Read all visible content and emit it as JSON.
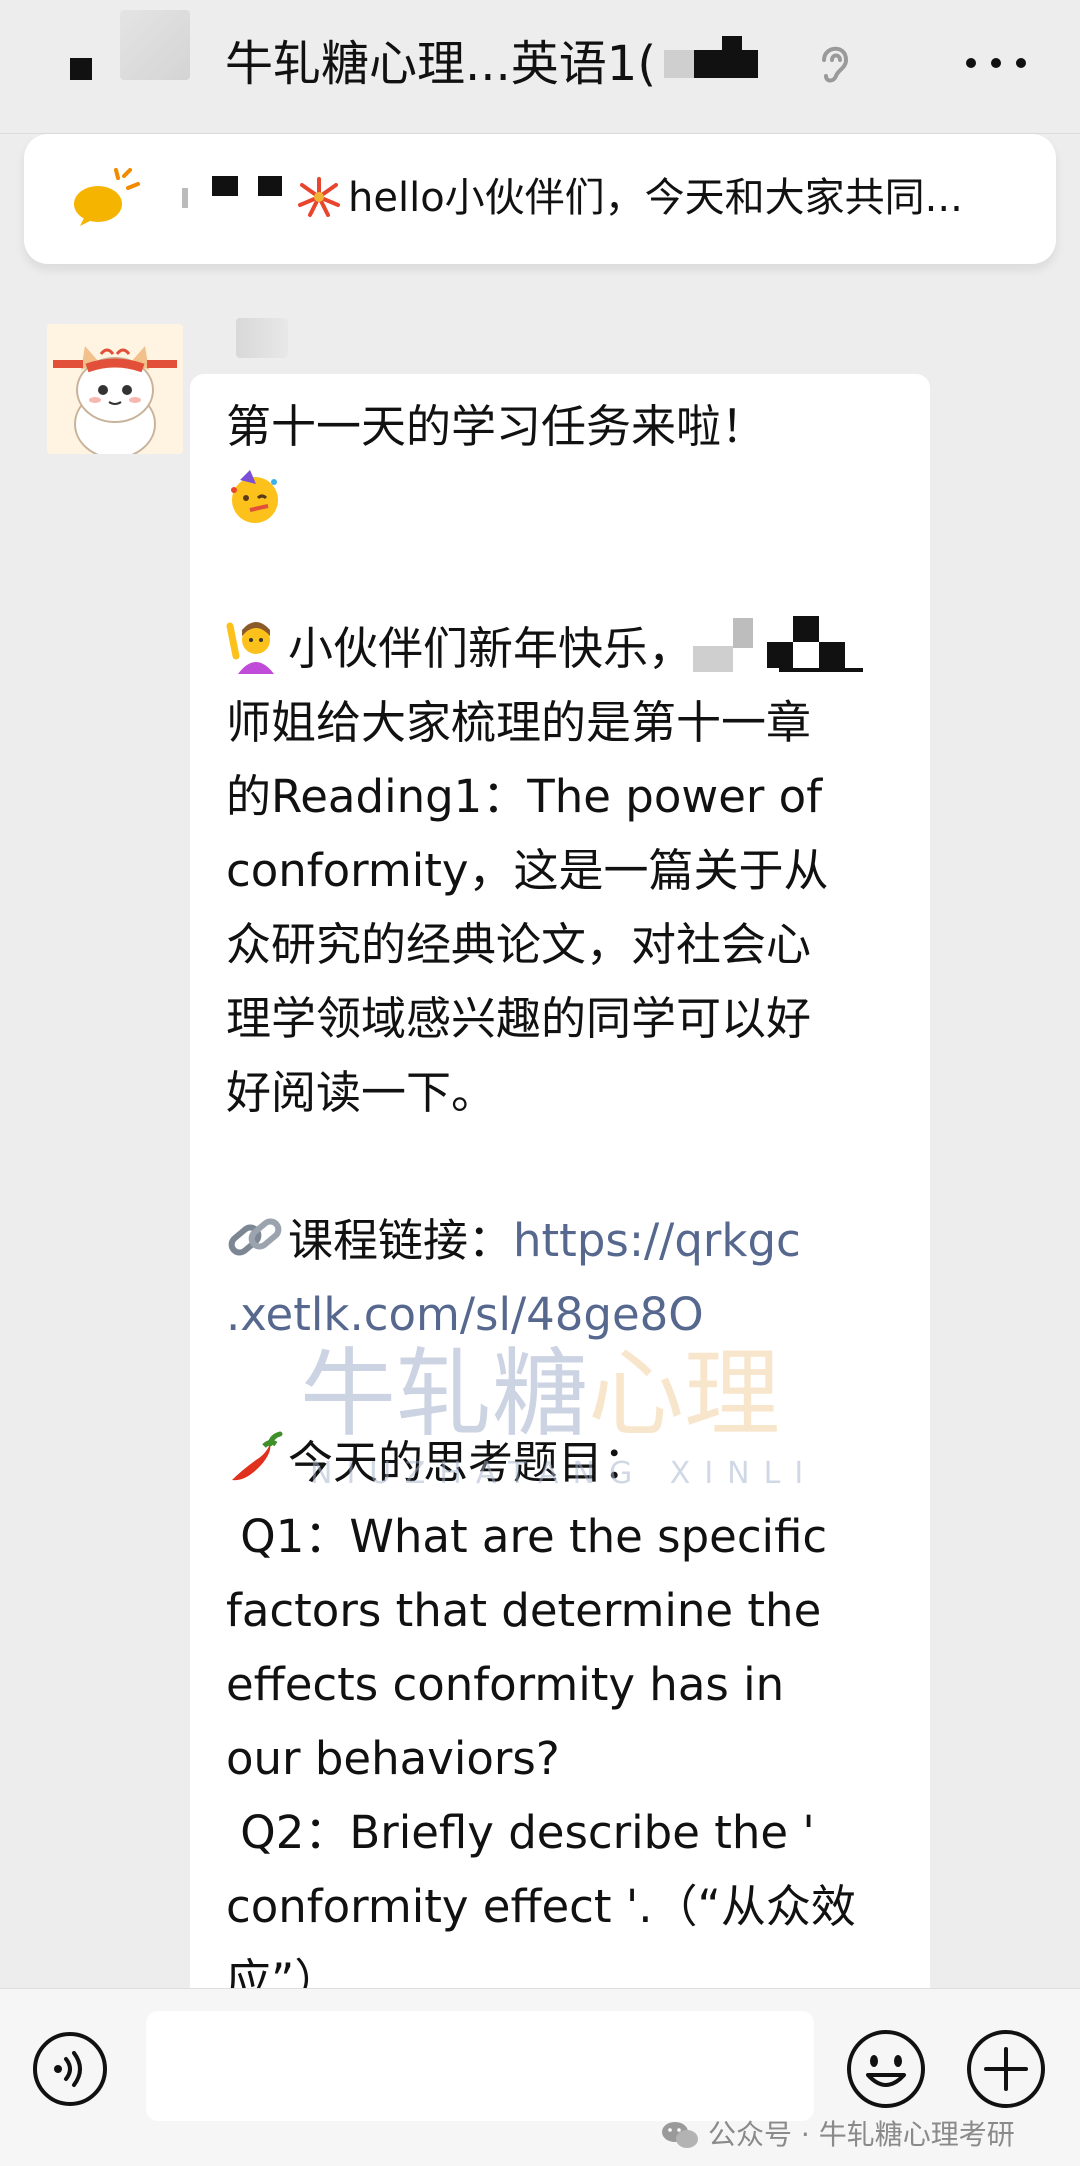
{
  "header": {
    "title": "牛轧糖心理...英语1(",
    "more_icon": "more-dots-icon",
    "ear_icon": "ear-icon"
  },
  "notice": {
    "text": "hello小伙伴们，今天和大家共同...",
    "icon": "megaphone-icon"
  },
  "message": {
    "lines": [
      "第十一天的学习任务来啦！",
      "",
      "",
      "小伙伴们新年快乐，",
      "师姐给大家梳理的是第十一章",
      "的Reading1：The power of",
      "conformity，这是一篇关于从",
      "众研究的经典论文，对社会心",
      "理学领域感兴趣的同学可以好",
      "好阅读一下。",
      "",
      "课程链接：",
      "",
      "",
      "今天的思考题目：",
      " Q1：What are the specific",
      "factors that determine the",
      "effects conformity has in",
      "our behaviors?",
      " Q2：Briefly describe the '",
      "conformity effect '.（“从众效",
      "应”）"
    ],
    "link_part1": "https://qrkgc",
    "link_part2": ".xetlk.com/sl/48ge8O"
  },
  "watermark": {
    "main_a": "牛轧糖",
    "main_b": "心理",
    "sub": "NIUZHATANG XINLI"
  },
  "footer": {
    "credit": "公众号 · 牛轧糖心理考研"
  },
  "colors": {
    "background": "#ededed",
    "link": "#57688f",
    "bubble": "#ffffff"
  }
}
